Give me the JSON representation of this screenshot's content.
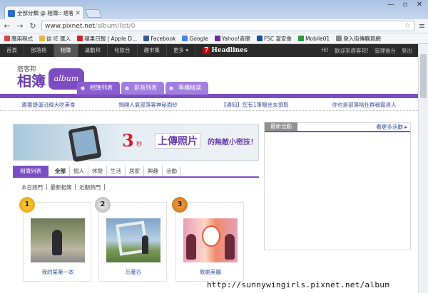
{
  "browser": {
    "tab_title": "全部分類 @ 相簿:: 痞客邦",
    "url_domain": "www.pixnet.net",
    "url_path": "/album/list/0",
    "bookmarks": [
      {
        "label": "應用程式",
        "color": "#d44"
      },
      {
        "label": "從 IE 匯入",
        "color": "#e8b640"
      },
      {
        "label": "蘋果日報 | Apple D...",
        "color": "#c22"
      },
      {
        "label": "Facebook",
        "color": "#3b5998"
      },
      {
        "label": "Google",
        "color": "#4285f4"
      },
      {
        "label": "Yahoo!奇摩",
        "color": "#6b2fa0"
      },
      {
        "label": "FSC 富安會",
        "color": "#1a4f99"
      },
      {
        "label": "Mobile01",
        "color": "#2a9d3a"
      },
      {
        "label": "登入街傳購買網",
        "color": "#888"
      }
    ]
  },
  "site_nav": {
    "items": [
      "首頁",
      "部落格",
      "相簿",
      "運動邦",
      "化妝台",
      "趣市集",
      "更多 ▾"
    ],
    "headlines_num": "7",
    "headlines_label": "Headlines",
    "right": [
      "Hi!",
      "歡迎來痞客邦!",
      "管理後台",
      "登出"
    ]
  },
  "logo": {
    "small": "痞客邦",
    "big": "相簿",
    "bubble": "album"
  },
  "section_tabs": [
    "相簿列表",
    "影音列表",
    "專欄精選"
  ],
  "marquee": [
    "跟著捷運沿線大吃美食",
    "揭開人氣部落客神秘面紗",
    "【通知】您有1筆贈金未領取",
    "你也是部落格社群稱霸達人"
  ],
  "banner": {
    "num": "3",
    "sec": "秒",
    "upload": "上傳照片",
    "rest": "的無敵小密技！"
  },
  "album_tabs": {
    "main": "相簿列表",
    "items": [
      "全部",
      "個人",
      "休閒",
      "生活",
      "居家",
      "興趣",
      "活動"
    ]
  },
  "sub_filter": [
    "本日熱門",
    "最新相簿",
    "近期熱門"
  ],
  "cards": [
    {
      "rank": "1",
      "caption": "我的某第一本"
    },
    {
      "rank": "2",
      "caption": "忘憂谷"
    },
    {
      "rank": "3",
      "caption": "致謝美麗"
    }
  ],
  "sidebar": {
    "title": "最新活動",
    "more": "看更多活動 ▸"
  },
  "watermark": "http://sunnywingirls.pixnet.net/album"
}
